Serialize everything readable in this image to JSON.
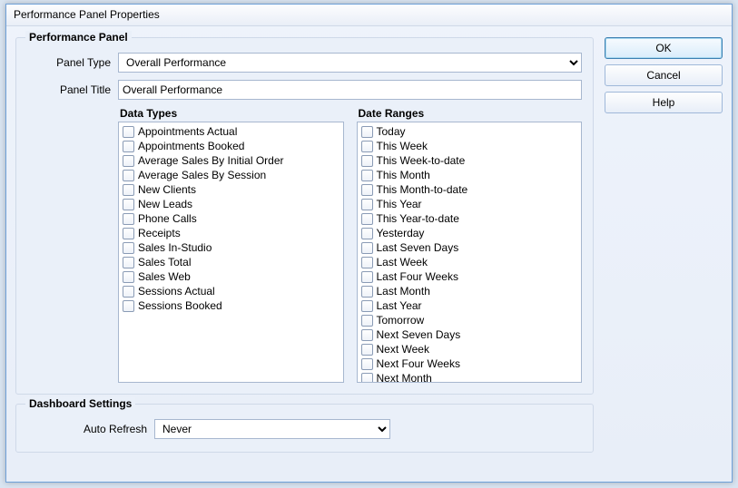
{
  "window": {
    "title": "Performance Panel Properties"
  },
  "buttons": {
    "ok": "OK",
    "cancel": "Cancel",
    "help": "Help"
  },
  "performance_panel": {
    "legend": "Performance Panel",
    "panel_type_label": "Panel Type",
    "panel_type_value": "Overall Performance",
    "panel_title_label": "Panel Title",
    "panel_title_value": "Overall Performance",
    "data_types_label": "Data Types",
    "date_ranges_label": "Date Ranges",
    "data_types": [
      "Appointments Actual",
      "Appointments Booked",
      "Average Sales By Initial Order",
      "Average Sales By Session",
      "New Clients",
      "New Leads",
      "Phone Calls",
      "Receipts",
      "Sales In-Studio",
      "Sales Total",
      "Sales Web",
      "Sessions Actual",
      "Sessions Booked"
    ],
    "date_ranges": [
      "Today",
      "This Week",
      "This Week-to-date",
      "This Month",
      "This Month-to-date",
      "This Year",
      "This Year-to-date",
      "Yesterday",
      "Last Seven Days",
      "Last Week",
      "Last Four Weeks",
      "Last Month",
      "Last Year",
      "Tomorrow",
      "Next Seven Days",
      "Next Week",
      "Next Four Weeks",
      "Next Month"
    ]
  },
  "dashboard": {
    "legend": "Dashboard Settings",
    "auto_refresh_label": "Auto Refresh",
    "auto_refresh_value": "Never"
  }
}
